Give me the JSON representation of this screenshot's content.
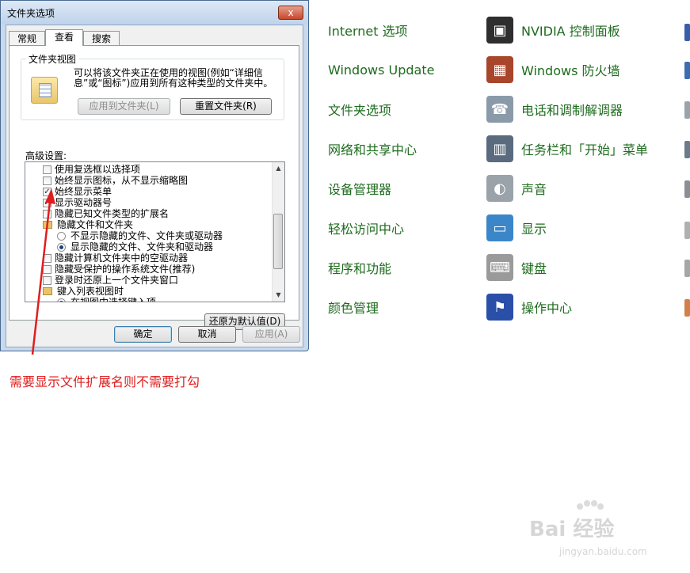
{
  "control_panel": {
    "items": [
      {
        "label": "Internet 选项",
        "icon": "internet-options-icon",
        "color": "#3a8fd6"
      },
      {
        "label": "NVIDIA 控制面板",
        "icon": "nvidia-icon",
        "color": "#2e2e2e"
      },
      {
        "label": "Windows Update",
        "icon": "windows-update-icon",
        "color": "#3a8a3a"
      },
      {
        "label": "Windows 防火墙",
        "icon": "firewall-icon",
        "color": "#a8452a"
      },
      {
        "label": "文件夹选项",
        "icon": "folder-options-icon",
        "color": "#e3b94a"
      },
      {
        "label": "电话和调制解调器",
        "icon": "phone-modem-icon",
        "color": "#8a9aa8"
      },
      {
        "label": "网络和共享中心",
        "icon": "network-icon",
        "color": "#3f6fb5"
      },
      {
        "label": "任务栏和「开始」菜单",
        "icon": "taskbar-icon",
        "color": "#5a6b80"
      },
      {
        "label": "设备管理器",
        "icon": "device-manager-icon",
        "color": "#6b7b8c"
      },
      {
        "label": "声音",
        "icon": "sound-icon",
        "color": "#9aa2aa"
      },
      {
        "label": "轻松访问中心",
        "icon": "ease-of-access-icon",
        "color": "#2f6dbf"
      },
      {
        "label": "显示",
        "icon": "display-icon",
        "color": "#3b86c9"
      },
      {
        "label": "程序和功能",
        "icon": "programs-icon",
        "color": "#6b8fb5"
      },
      {
        "label": "键盘",
        "icon": "keyboard-icon",
        "color": "#9a9a9a"
      },
      {
        "label": "颜色管理",
        "icon": "color-management-icon",
        "color": "#c94a3a"
      },
      {
        "label": "操作中心",
        "icon": "action-center-flag-icon",
        "color": "#2a4fa8"
      }
    ]
  },
  "dialog": {
    "title": "文件夹选项",
    "close_glyph": "x",
    "tabs": [
      "常规",
      "查看",
      "搜索"
    ],
    "active_tab": "查看",
    "folder_views": {
      "group_title": "文件夹视图",
      "description": "可以将该文件夹正在使用的视图(例如“详细信息”或“图标”)应用到所有这种类型的文件夹中。",
      "apply_button": "应用到文件夹(L)",
      "reset_button": "重置文件夹(R)"
    },
    "advanced": {
      "label": "高级设置:",
      "rows": [
        {
          "type": "checkbox",
          "checked": false,
          "text": "使用复选框以选择项"
        },
        {
          "type": "checkbox",
          "checked": false,
          "text": "始终显示图标，从不显示缩略图"
        },
        {
          "type": "checkbox",
          "checked": true,
          "text": "始终显示菜单"
        },
        {
          "type": "checkbox",
          "checked": true,
          "text": "显示驱动器号"
        },
        {
          "type": "checkbox",
          "checked": false,
          "text": "隐藏已知文件类型的扩展名"
        },
        {
          "type": "folder",
          "text": "隐藏文件和文件夹"
        },
        {
          "type": "radio",
          "checked": false,
          "text": "不显示隐藏的文件、文件夹或驱动器"
        },
        {
          "type": "radio",
          "checked": true,
          "text": "显示隐藏的文件、文件夹和驱动器"
        },
        {
          "type": "checkbox",
          "checked": false,
          "text": "隐藏计算机文件夹中的空驱动器"
        },
        {
          "type": "checkbox",
          "checked": false,
          "text": "隐藏受保护的操作系统文件(推荐)"
        },
        {
          "type": "checkbox",
          "checked": false,
          "text": "登录时还原上一个文件夹窗口"
        },
        {
          "type": "folder",
          "text": "键入列表视图时"
        },
        {
          "type": "radio",
          "checked": true,
          "text": "在视图中选择键入项"
        }
      ],
      "restore_defaults_button": "还原为默认值(D)"
    },
    "footer": {
      "ok": "确定",
      "cancel": "取消",
      "apply": "应用(A)"
    }
  },
  "annotation": {
    "text": "需要显示文件扩展名则不需要打勾",
    "color": "#e01d1d"
  },
  "watermark": {
    "brand": "Bai  经验",
    "url": "jingyan.baidu.com"
  }
}
